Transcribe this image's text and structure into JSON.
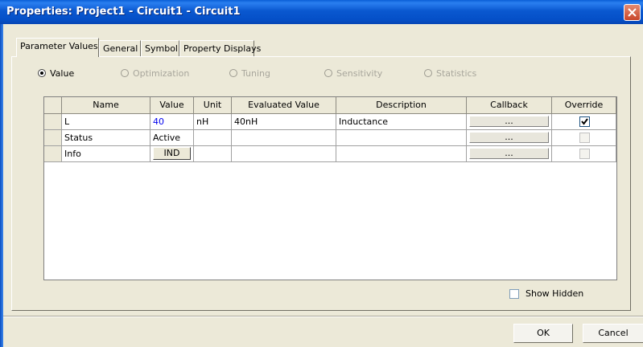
{
  "window": {
    "title": "Properties: Project1 - Circuit1 - Circuit1"
  },
  "tabs": [
    {
      "label": "Parameter Values",
      "active": true
    },
    {
      "label": "General",
      "active": false
    },
    {
      "label": "Symbol",
      "active": false
    },
    {
      "label": "Property Displays",
      "active": false
    }
  ],
  "modes": [
    {
      "label": "Value",
      "selected": true,
      "enabled": true
    },
    {
      "label": "Optimization",
      "selected": false,
      "enabled": false
    },
    {
      "label": "Tuning",
      "selected": false,
      "enabled": false
    },
    {
      "label": "Sensitivity",
      "selected": false,
      "enabled": false
    },
    {
      "label": "Statistics",
      "selected": false,
      "enabled": false
    }
  ],
  "grid": {
    "columns": [
      "Name",
      "Value",
      "Unit",
      "Evaluated Value",
      "Description",
      "Callback",
      "Override"
    ],
    "rows": [
      {
        "name": "L",
        "value": "40",
        "unit": "nH",
        "evaluated": "40nH",
        "description": "Inductance",
        "callback": "...",
        "override": true
      },
      {
        "name": "Status",
        "value": "Active",
        "unit": "",
        "evaluated": "",
        "description": "",
        "callback": "...",
        "override": false
      },
      {
        "name": "Info",
        "value": "IND",
        "unit": "",
        "evaluated": "",
        "description": "",
        "callback": "...",
        "override": false
      }
    ]
  },
  "show_hidden": {
    "label": "Show Hidden",
    "checked": false
  },
  "buttons": {
    "ok": "OK",
    "cancel": "Cancel"
  },
  "colors": {
    "titlebar": "#0a58d0",
    "dialog_bg": "#ece9d8",
    "value_link": "#0000ee"
  }
}
